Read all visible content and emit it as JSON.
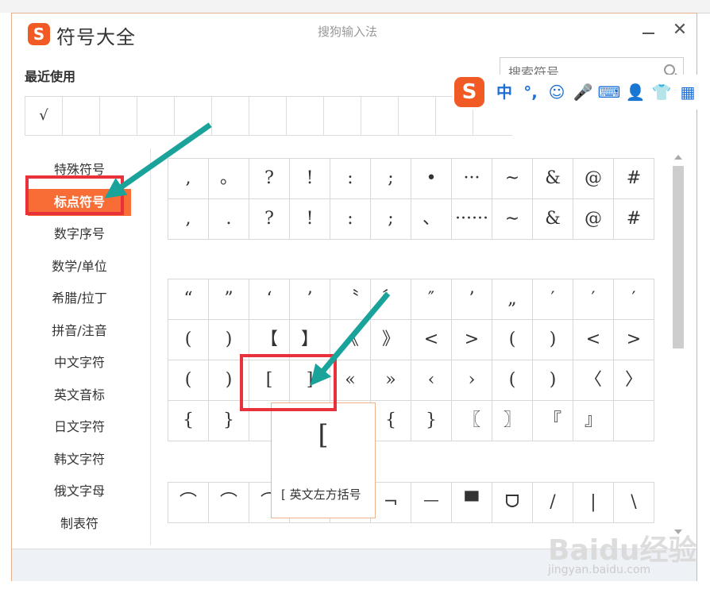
{
  "dialog": {
    "title": "符号大全",
    "subtitle": "搜狗输入法",
    "logo_letter": "S",
    "minimize_icon": "minimize-icon",
    "close_glyph": "✕",
    "recent_label": "最近使用",
    "search_placeholder": "搜索符号",
    "recent_symbols": [
      "√",
      "",
      "",
      "",
      "",
      "",
      "",
      "",
      "",
      "",
      "",
      "",
      ""
    ]
  },
  "ime_toolbar": {
    "logo_letter": "S",
    "items": [
      "中",
      "°,",
      "☺",
      "🎤",
      "⌨",
      "👤",
      "👕",
      "▦"
    ]
  },
  "sidebar": {
    "items": [
      "特殊符号",
      "标点符号",
      "数字序号",
      "数学/单位",
      "希腊/拉丁",
      "拼音/注音",
      "中文字符",
      "英文音标",
      "日文字符",
      "韩文字符",
      "俄文字母",
      "制表符"
    ],
    "active_index": 1
  },
  "symbols": {
    "group1": [
      [
        ",",
        "。",
        "?",
        "!",
        ":",
        ";",
        "•",
        "···",
        "~",
        "&",
        "@",
        "#"
      ],
      [
        ",",
        ".",
        "?",
        "!",
        ":",
        ";",
        "、",
        "······",
        "∼",
        "&",
        "@",
        "#"
      ]
    ],
    "group2": [
      [
        "“",
        "”",
        "‘",
        "’",
        "〝",
        "〞",
        "″",
        "’",
        "„",
        "′",
        "′",
        "′"
      ],
      [
        "(",
        ")",
        "【",
        "】",
        "《",
        "》",
        "<",
        ">",
        "(",
        ")",
        "<",
        ">"
      ],
      [
        "(",
        ")",
        "[",
        "]",
        "«",
        "»",
        "‹",
        "›",
        "(",
        ")",
        "〈",
        "〉"
      ],
      [
        "{",
        "}",
        "",
        "",
        "」",
        "{",
        "}",
        "〖",
        "〗",
        "『",
        "』",
        ""
      ]
    ],
    "group3": [
      [
        "⌒",
        "⌒",
        "⌒",
        "",
        "",
        "¬",
        "ᅳ",
        "▀",
        "ᗜ",
        "/",
        "|",
        "\\"
      ]
    ]
  },
  "tooltip": {
    "symbol": "[",
    "description": "[ 英文左方括号"
  },
  "watermark": {
    "brand": "Baidu经验",
    "url": "jingyan.baidu.com"
  },
  "colors": {
    "accent": "#f86d36",
    "highlight": "#e8313a",
    "arrow": "#1aa39a",
    "ime_blue": "#1c6fd6"
  }
}
